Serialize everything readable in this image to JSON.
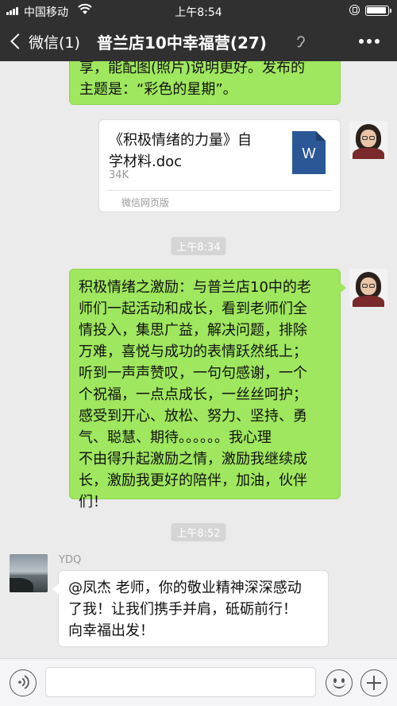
{
  "status_bar": {
    "carrier": "中国移动",
    "time": "上午8:54"
  },
  "nav": {
    "back_label": "微信(1)",
    "title": "普兰店10中幸福营(27)"
  },
  "messages": {
    "m1_lines": [
      "享，能配图(照片)说明更好。发布的",
      "主题是：“彩色的星期”。"
    ],
    "file": {
      "name_line1": "《积极情绪的力量》自",
      "name_line2": "学材料.doc",
      "size": "34K",
      "source": "微信网页版",
      "icon_letter": "W"
    },
    "time1": "上午8:34",
    "m2_lines": [
      "积极情绪之激励：与普兰店10中的老",
      "师们一起活动和成长，看到老师们全",
      "情投入，集思广益，解决问题，排除",
      "万难，喜悦与成功的表情跃然纸上；",
      "听到一声声赞叹，一句句感谢，一个",
      "个祝福，一点点成长，一丝丝呵护；",
      "感受到开心、放松、努力、坚持、勇",
      "气、聪慧、期待。。。。。。我心理",
      "不由得升起激励之情，激励我继续成",
      "长，激励我更好的陪伴，加油，伙伴",
      "们！"
    ],
    "time2": "上午8:52",
    "sender_name": "YDQ",
    "m3_lines": [
      "@凤杰 老师，你的敬业精神深深感动",
      "了我！让我们携手并肩，砥砺前行！",
      "向幸福出发！"
    ]
  },
  "colors": {
    "bar_bg": "#303030",
    "chat_bg": "#ebebeb",
    "green_bubble": "#9fe75e",
    "word_blue": "#2b5797"
  }
}
